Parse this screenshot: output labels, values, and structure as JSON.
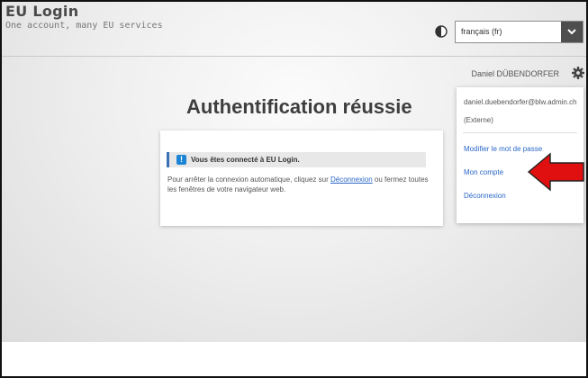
{
  "header": {
    "title": "EU Login",
    "subtitle": "One account, many EU services",
    "language_selected": "français (fr)"
  },
  "user": {
    "name": "Daniel DÜBENDORFER",
    "email": "daniel.duebendorfer@blw.admin.ch",
    "account_type": "(Externe)"
  },
  "main": {
    "title": "Authentification réussie",
    "notice": "Vous êtes connecté à EU Login.",
    "body_before": "Pour arrêter la connexion automatique, cliquez sur ",
    "body_link": "Déconnexion",
    "body_after": " ou fermez toutes les fenêtres de votre navigateur web."
  },
  "dropdown": {
    "items": [
      "Modifier le mot de passe",
      "Mon compte",
      "Déconnexion"
    ]
  },
  "colors": {
    "link": "#2a67c7",
    "notice_icon": "#1b84d4",
    "arrow": "#e01010",
    "select_button": "#4e4e4e"
  },
  "icons": {
    "contrast": "contrast-icon",
    "gear": "gear-icon",
    "chevron": "chevron-down-icon",
    "info": "info-icon",
    "annotation": "arrow-left-icon"
  }
}
